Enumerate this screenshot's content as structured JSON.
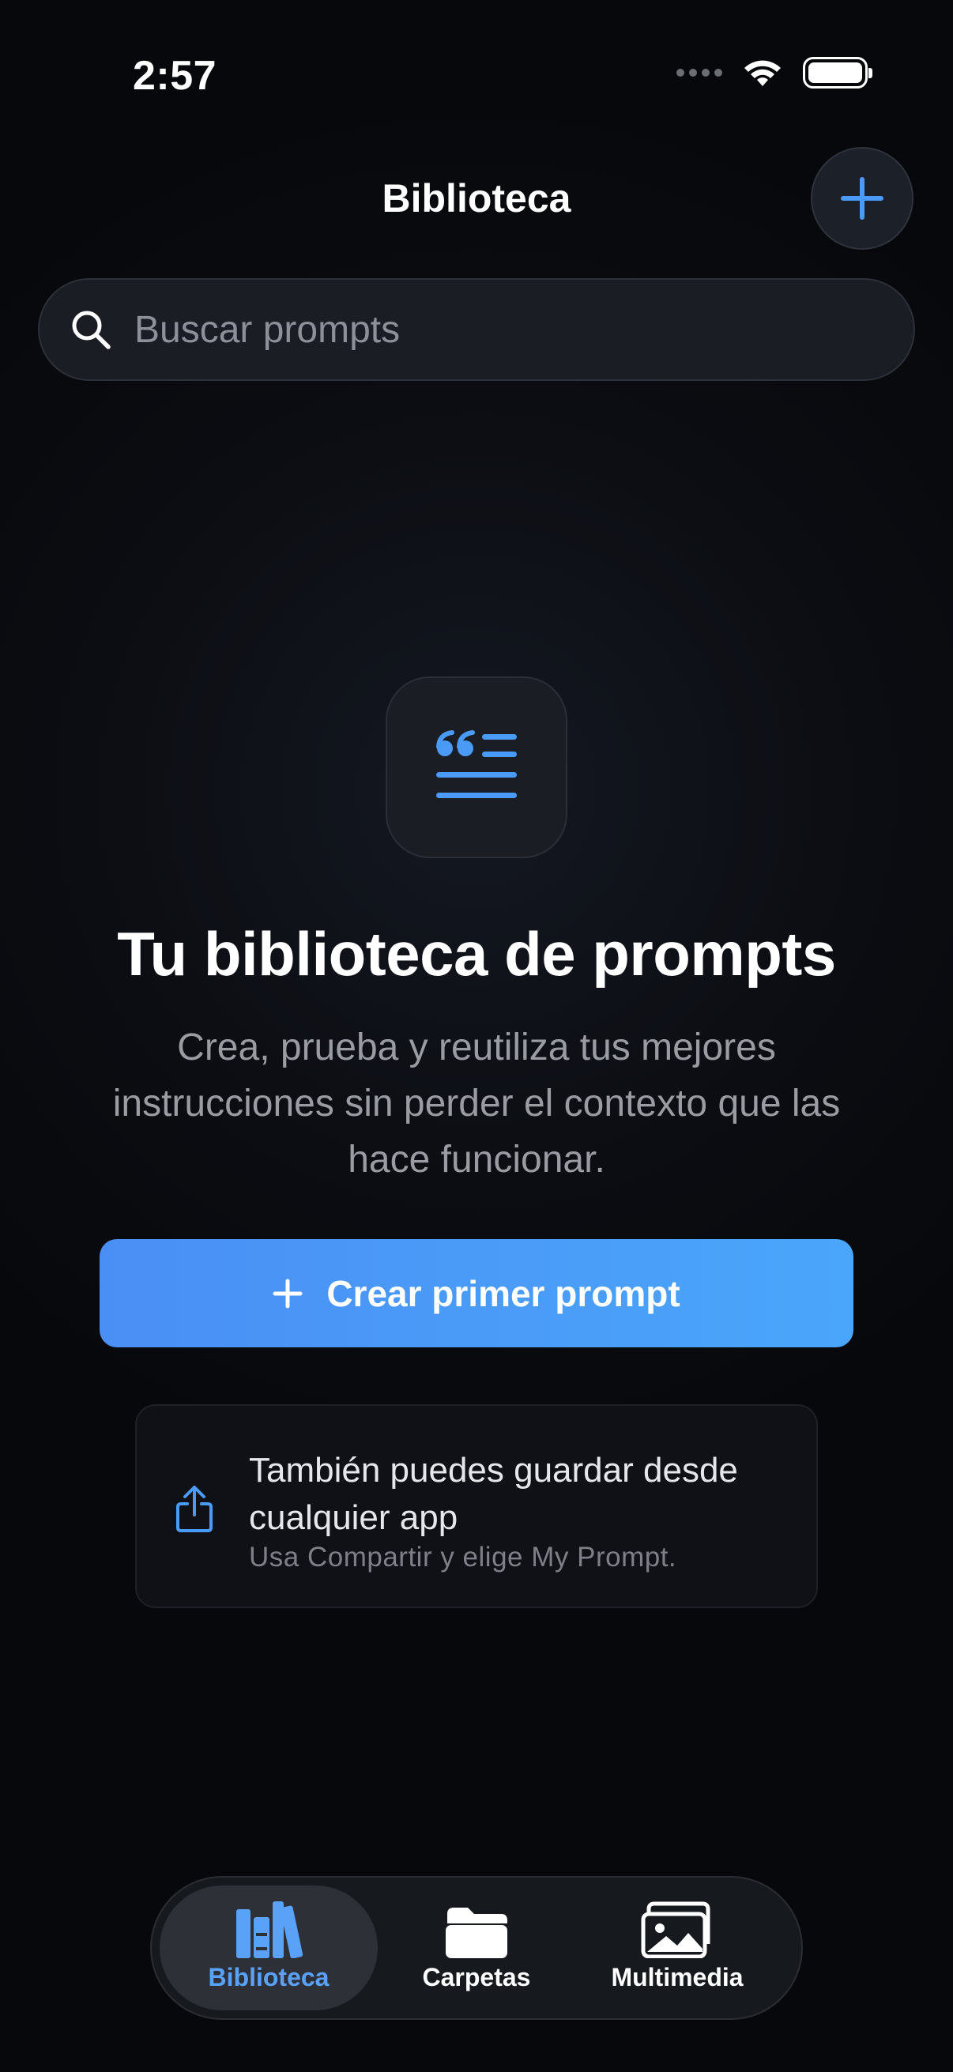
{
  "status_bar": {
    "time": "2:57"
  },
  "header": {
    "title": "Biblioteca"
  },
  "search": {
    "placeholder": "Buscar prompts"
  },
  "empty_state": {
    "icon": "quote-text-icon",
    "title": "Tu biblioteca de prompts",
    "description": "Crea, prueba y reutiliza tus mejores instrucciones sin perder el contexto que las hace funcionar.",
    "primary_button": "Crear primer prompt"
  },
  "share_card": {
    "icon": "share-icon",
    "title": "También puedes guardar desde cualquier app",
    "subtitle": "Usa Compartir y elige My Prompt."
  },
  "tabs": [
    {
      "label": "Biblioteca",
      "icon": "books-icon",
      "active": true
    },
    {
      "label": "Carpetas",
      "icon": "folder-icon",
      "active": false
    },
    {
      "label": "Multimedia",
      "icon": "photos-icon",
      "active": false
    }
  ],
  "colors": {
    "accent": "#4a9af7",
    "background": "#0b0d12"
  }
}
